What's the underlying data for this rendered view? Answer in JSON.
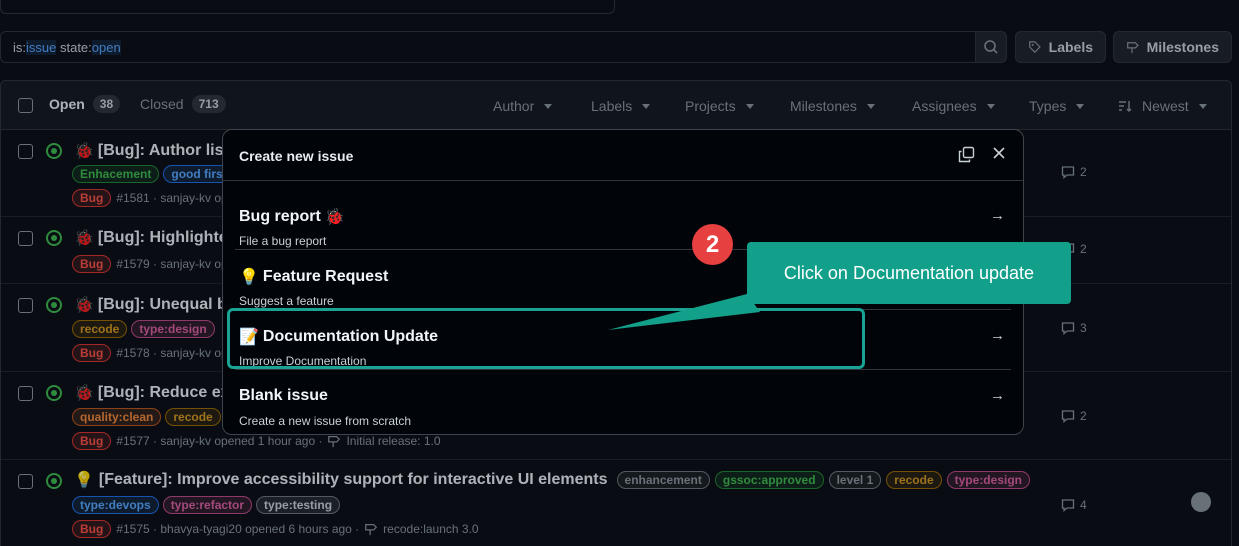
{
  "search": {
    "prefix1": "is:",
    "value1": "issue",
    "prefix2": " state:",
    "value2": "open"
  },
  "toolbar": {
    "labels_btn": "Labels",
    "milestones_btn": "Milestones"
  },
  "tabs": {
    "open_label": "Open",
    "open_count": "38",
    "closed_label": "Closed",
    "closed_count": "713"
  },
  "filters": [
    "Author",
    "Labels",
    "Projects",
    "Milestones",
    "Assignees",
    "Types",
    "Newest"
  ],
  "issues": [
    {
      "title": "[Bug]: Author list",
      "icon": "bug-icon",
      "labels": [
        {
          "text": "Enhacement",
          "color": "#3fb950"
        },
        {
          "text": "good first",
          "color": "#58a6ff"
        }
      ],
      "status_label": "Bug",
      "meta": "#1581 · sanjay-kv op",
      "comments": "2"
    },
    {
      "title": "[Bug]: Highlighted",
      "icon": "bug-icon",
      "labels": [],
      "status_label": "Bug",
      "meta": "#1579 · sanjay-kv op",
      "comments": "2"
    },
    {
      "title": "[Bug]: Unequal bo",
      "icon": "bug-icon",
      "labels": [
        {
          "text": "recode",
          "color": "#d29922"
        },
        {
          "text": "type:design",
          "color": "#db61a2"
        }
      ],
      "status_label": "Bug",
      "meta": "#1578 · sanjay-kv op",
      "comments": "3"
    },
    {
      "title": "[Bug]: Reduce ext",
      "icon": "bug-icon",
      "labels": [
        {
          "text": "quality:clean",
          "color": "#f0883e"
        },
        {
          "text": "recode",
          "color": "#d29922"
        }
      ],
      "status_label": "Bug",
      "meta": "#1577 · sanjay-kv opened 1 hour ago ·",
      "milestone": "Initial release: 1.0",
      "comments": "2"
    },
    {
      "title": "[Feature]: Improve accessibility support for interactive UI elements",
      "icon": "lightbulb-icon",
      "title_labels": [
        {
          "text": "enhancement",
          "color": "#8b949e"
        },
        {
          "text": "gssoc:approved",
          "color": "#3fb950"
        },
        {
          "text": "level 1",
          "color": "#8b949e"
        },
        {
          "text": "recode",
          "color": "#d29922"
        },
        {
          "text": "type:design",
          "color": "#db61a2"
        }
      ],
      "labels": [
        {
          "text": "type:devops",
          "color": "#58a6ff"
        },
        {
          "text": "type:refactor",
          "color": "#db61a2"
        },
        {
          "text": "type:testing",
          "color": "#c9d1d9"
        }
      ],
      "status_label": "Bug",
      "meta": "#1575 · bhavya-tyagi20 opened 6 hours ago ·",
      "milestone": "recode:launch 3.0",
      "comments": "4"
    }
  ],
  "modal": {
    "title": "Create new issue",
    "options": [
      {
        "title": "Bug report",
        "desc": "File a bug report",
        "icon": "bug-icon"
      },
      {
        "title": "Feature Request",
        "desc": "Suggest a feature",
        "icon": "lightbulb-icon"
      },
      {
        "title": "Documentation Update",
        "desc": "Improve Documentation",
        "icon": "document-icon"
      },
      {
        "title": "Blank issue",
        "desc": "Create a new issue from scratch",
        "icon": ""
      }
    ]
  },
  "annotation": {
    "step_number": "2",
    "callout_text": "Click on Documentation update",
    "accent": "#13a08b",
    "step_color": "#e64040"
  }
}
